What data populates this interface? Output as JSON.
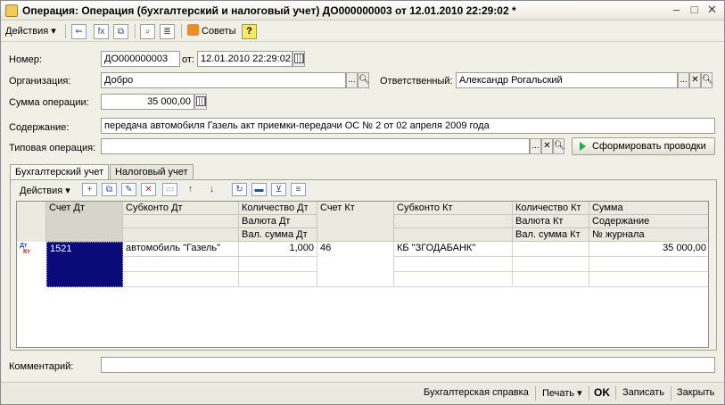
{
  "window": {
    "title": "Операция: Операция (бухгалтерский и налоговый учет) ДО000000003 от 12.01.2010 22:29:02 *",
    "min_glyph": "–",
    "max_glyph": "□",
    "close_glyph": "✕"
  },
  "toolbar": {
    "actions_label": "Действия",
    "dropdown_glyph": "▾",
    "sovety_label": "Советы",
    "help_glyph": "?",
    "icons": [
      "arrow-left-icon",
      "formula-icon",
      "copy-icon",
      "find-doc-icon",
      "journal-icon",
      "pen-icon"
    ]
  },
  "form": {
    "nomer_label": "Номер:",
    "nomer_value": "ДО000000003",
    "ot_label": "от:",
    "ot_value": "12.01.2010 22:29:02",
    "org_label": "Организация:",
    "org_value": "Добро",
    "resp_label": "Ответственный:",
    "resp_value": "Александр Рогальский",
    "sum_label": "Сумма операции:",
    "sum_value": "35 000,00",
    "content_label": "Содержание:",
    "content_value": "передача автомобиля Газель акт приемки-передачи ОС № 2 от 02 апреля 2009 года",
    "typical_label": "Типовая операция:",
    "typical_value": "",
    "generate_label": "Сформировать проводки",
    "btn_dots": "...",
    "btn_search": "🔍︎",
    "btn_clear": "✕"
  },
  "tabs": [
    {
      "label": "Бухгалтерский учет",
      "active": true
    },
    {
      "label": "Налоговый учет",
      "active": false
    }
  ],
  "grid_toolbar": {
    "actions_label": "Действия",
    "up_glyph": "↑",
    "down_glyph": "↓"
  },
  "grid": {
    "headers": {
      "schet_dt": "Счет Дт",
      "subkonto_dt": "Субконто Дт",
      "kol_dt": "Количество Дт",
      "valuta_dt": "Валюта Дт",
      "val_summa_dt": "Вал. сумма Дт",
      "schet_kt": "Счет Кт",
      "subkonto_kt": "Субконто Кт",
      "kol_kt": "Количество Кт",
      "valuta_kt": "Валюта Кт",
      "val_summa_kt": "Вал. сумма Кт",
      "summa": "Сумма",
      "soderzhanie": "Содержание",
      "nomer_zhurnala": "№ журнала"
    },
    "row": {
      "icon_dt": "Дт",
      "icon_kt": "Кт",
      "schet_dt": "1521",
      "subkonto_dt_1": "автомобиль \"Газель\"",
      "kol_dt": "1,000",
      "schet_kt": "46",
      "subkonto_kt_1": "КБ \"ЗГОДАБАНК\"",
      "summa": "35 000,00"
    }
  },
  "comment": {
    "label": "Комментарий:",
    "value": ""
  },
  "statusbar": {
    "spravka": "Бухгалтерская справка",
    "pechat": "Печать",
    "ok": "OK",
    "zapisat": "Записать",
    "zakryt": "Закрыть"
  }
}
